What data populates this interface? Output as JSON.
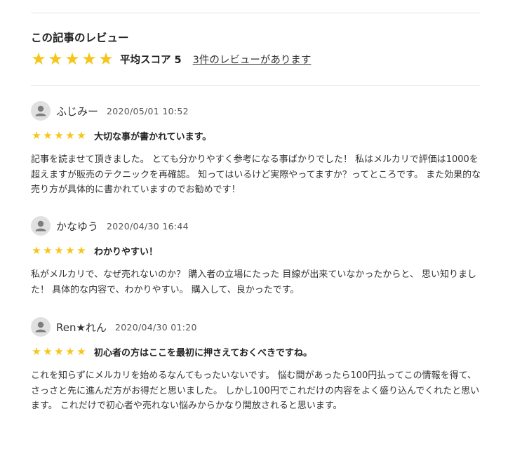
{
  "section": {
    "title": "この記事のレビュー",
    "average_label": "平均スコア 5",
    "average_score": 5,
    "review_count_link": "3件のレビューがあります"
  },
  "star_glyph": "★",
  "colors": {
    "star": "#f5c518",
    "avatar_bg": "#e0e0e0",
    "avatar_icon": "#7d7d7d",
    "divider": "#e2e2e2"
  },
  "reviews": [
    {
      "name": "ふじみー",
      "date": "2020/05/01 10:52",
      "rating": 5,
      "title": "大切な事が書かれています。",
      "body": "記事を読ませて頂きました。 とても分かりやすく参考になる事ばかりでした！ 私はメルカリで評価は1000を超えますが販売のテクニックを再確認。 知ってはいるけど実際やってますか？ってところです。 また効果的な売り方が具体的に書かれていますのでお勧めです！"
    },
    {
      "name": "かなゆう",
      "date": "2020/04/30 16:44",
      "rating": 5,
      "title": "わかりやすい！",
      "body": "私がメルカリで、なぜ売れないのか？ 購入者の立場にたった 目線が出来ていなかったからと、 思い知りました！ 具体的な内容で、わかりやすい。 購入して、良かったです。"
    },
    {
      "name": "Ren★れん",
      "date": "2020/04/30 01:20",
      "rating": 5,
      "title": "初心者の方はここを最初に押さえておくべきですね。",
      "body": "これを知らずにメルカリを始めるなんてもったいないです。 悩む間があったら100円払ってこの情報を得て、さっさと先に進んだ方がお得だと思いました。 しかし100円でこれだけの内容をよく盛り込んでくれたと思います。 これだけで初心者や売れない悩みからかなり開放されると思います。"
    }
  ]
}
